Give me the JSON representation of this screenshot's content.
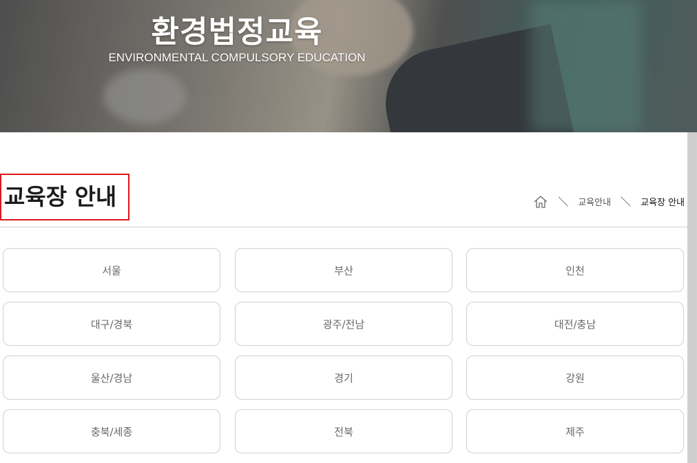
{
  "hero": {
    "title": "환경법정교육",
    "subtitle": "ENVIRONMENTAL COMPULSORY EDUCATION"
  },
  "page": {
    "title": "교육장 안내"
  },
  "breadcrumb": {
    "home_icon": "home-icon",
    "separator": "＼",
    "items": [
      "교육안내",
      "교육장 안내"
    ]
  },
  "regions": [
    "서울",
    "부산",
    "인천",
    "대구/경북",
    "광주/전남",
    "대전/충남",
    "울산/경남",
    "경기",
    "강원",
    "충북/세종",
    "전북",
    "제주"
  ],
  "colors": {
    "title_highlight_border": "#d8181e",
    "card_border": "#cfcfcf"
  }
}
